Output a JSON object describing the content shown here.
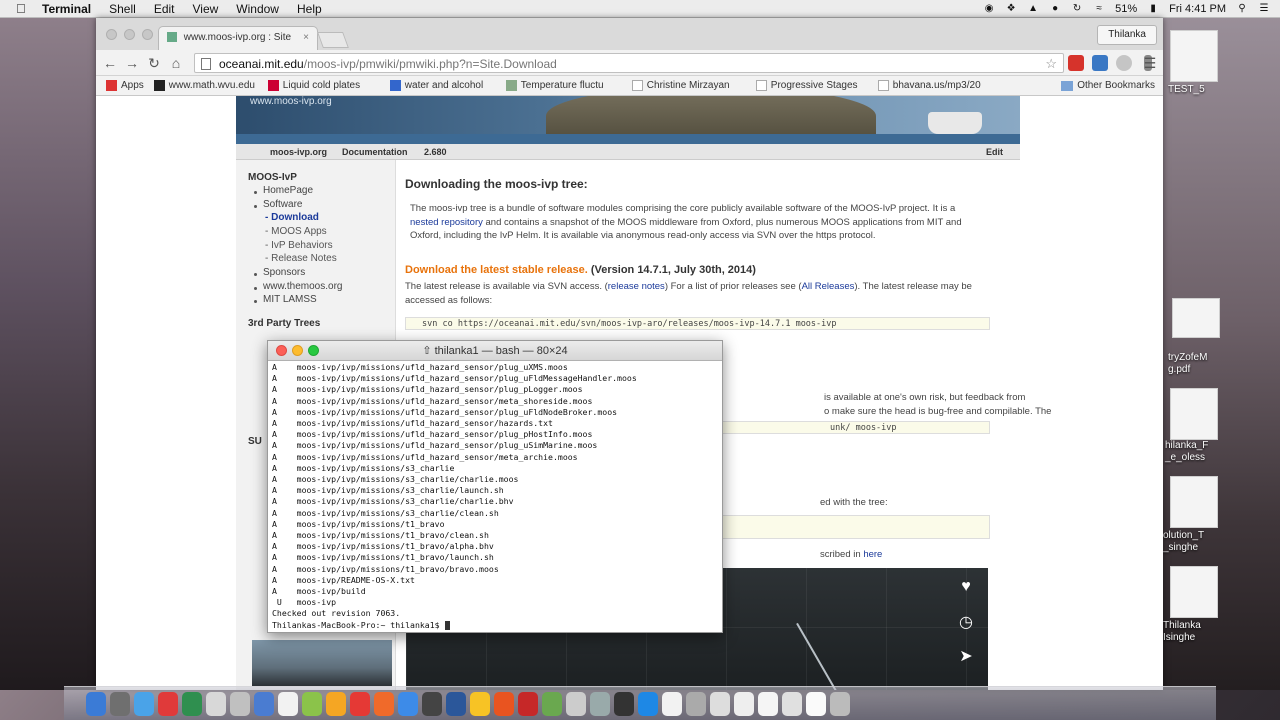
{
  "menubar": {
    "app": "Terminal",
    "menus": [
      "Shell",
      "Edit",
      "View",
      "Window",
      "Help"
    ],
    "battery": "51%",
    "clock": "Fri 4:41 PM",
    "user": "Thilanka"
  },
  "browser": {
    "tab_title": "www.moos-ivp.org : Site",
    "url_host": "oceanai.mit.edu",
    "url_path": "/moos-ivp/pmwiki/pmwiki.php?n=Site.Download",
    "profile": "Thilanka",
    "bookmarks": [
      "Apps",
      "www.math.wvu.edu",
      "Liquid cold plates",
      "water and alcohol",
      "Temperature fluctu",
      "Christine Mirzayan",
      "Progressive Stages",
      "bhavana.us/mp3/20"
    ],
    "other_bookmarks": "Other Bookmarks"
  },
  "wiki": {
    "banner_title": "www.moos-ivp.org",
    "header_site": "moos-ivp.org",
    "header_docs": "Documentation",
    "header_version": "2.680",
    "header_edit": "Edit",
    "sidebar": {
      "heading1": "MOOS-IvP",
      "items1": [
        "HomePage",
        "Software",
        "Sponsors",
        "www.themoos.org",
        "MIT LAMSS"
      ],
      "subitems": [
        "Download",
        "MOOS Apps",
        "IvP Behaviors",
        "Release Notes"
      ],
      "heading2": "3rd Party Trees",
      "heading3": "SU"
    },
    "page_title": "Downloading the moos-ivp tree:",
    "intro_1": "The moos-ivp tree is a bundle of software modules comprising the core publicly available software of the MOOS-IvP project. It is a ",
    "intro_link": "nested repository",
    "intro_2": " and contains a snapshot of the MOOS middleware from Oxford, plus numerous MOOS applications from MIT and Oxford, including the IvP Helm. It is available via anonymous read-only access via SVN over the https protocol.",
    "download_link": "Download the latest stable release.",
    "download_version": "(Version 14.7.1, July 30th, 2014)",
    "release_1": "The latest release is available via SVN access. (",
    "release_notes_link": "release notes",
    "release_2": ") For a list of prior releases see (",
    "all_releases_link": "All Releases",
    "release_3": "). The latest release may be accessed as follows:",
    "svn_command": "svn co https://oceanai.mit.edu/svn/moos-ivp-aro/releases/moos-ivp-14.7.1 moos-ivp",
    "trunk_text_1": "is available at one's own risk, but feedback from",
    "trunk_text_2": "o make sure the head is bug-free and compilable. The",
    "trunk_command": "unk/ moos-ivp",
    "tree_text": "ed with the tree:",
    "here_text": "scribed in ",
    "here_link": "here"
  },
  "terminal": {
    "title": "thilanka1 — bash — 80×24",
    "lines": [
      "A    moos-ivp/ivp/missions/ufld_hazard_sensor/plug_uXMS.moos",
      "A    moos-ivp/ivp/missions/ufld_hazard_sensor/plug_uFldMessageHandler.moos",
      "A    moos-ivp/ivp/missions/ufld_hazard_sensor/plug_pLogger.moos",
      "A    moos-ivp/ivp/missions/ufld_hazard_sensor/meta_shoreside.moos",
      "A    moos-ivp/ivp/missions/ufld_hazard_sensor/plug_uFldNodeBroker.moos",
      "A    moos-ivp/ivp/missions/ufld_hazard_sensor/hazards.txt",
      "A    moos-ivp/ivp/missions/ufld_hazard_sensor/plug_pHostInfo.moos",
      "A    moos-ivp/ivp/missions/ufld_hazard_sensor/plug_uSimMarine.moos",
      "A    moos-ivp/ivp/missions/ufld_hazard_sensor/meta_archie.moos",
      "A    moos-ivp/ivp/missions/s3_charlie",
      "A    moos-ivp/ivp/missions/s3_charlie/charlie.moos",
      "A    moos-ivp/ivp/missions/s3_charlie/launch.sh",
      "A    moos-ivp/ivp/missions/s3_charlie/charlie.bhv",
      "A    moos-ivp/ivp/missions/s3_charlie/clean.sh",
      "A    moos-ivp/ivp/missions/t1_bravo",
      "A    moos-ivp/ivp/missions/t1_bravo/clean.sh",
      "A    moos-ivp/ivp/missions/t1_bravo/alpha.bhv",
      "A    moos-ivp/ivp/missions/t1_bravo/launch.sh",
      "A    moos-ivp/ivp/missions/t1_bravo/bravo.moos",
      "A    moos-ivp/README-OS-X.txt",
      "A    moos-ivp/build",
      " U   moos-ivp",
      "Checked out revision 7063.",
      "Thilankas-MacBook-Pro:~ thilanka1$ "
    ]
  },
  "desktop": {
    "labels": [
      "TEST_5",
      "tryZofeM",
      "g.pdf",
      "hilanka_F",
      "_e_oless",
      "olution_T",
      "_singhe",
      "Thilanka",
      "Isinghe"
    ]
  },
  "colors": {
    "link": "#1b3a9a",
    "download_orange": "#e8730c"
  }
}
